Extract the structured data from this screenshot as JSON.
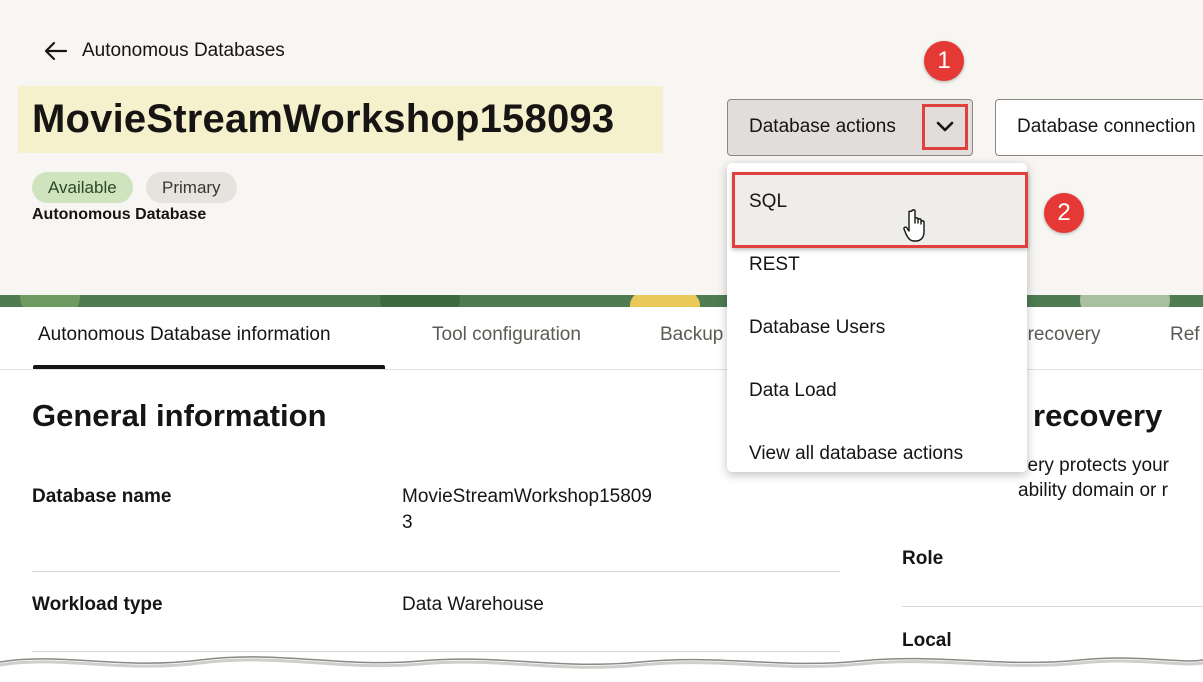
{
  "header": {
    "back_link": "Autonomous Databases",
    "title": "MovieStreamWorkshop158093",
    "badges": [
      "Available",
      "Primary"
    ],
    "subtitle": "Autonomous Database"
  },
  "actions": {
    "database_actions": "Database actions",
    "database_connection": "Database connection"
  },
  "steps": [
    "1",
    "2"
  ],
  "dropdown": {
    "items": [
      "SQL",
      "REST",
      "Database Users",
      "Data Load",
      "View all database actions"
    ]
  },
  "tabs": [
    "Autonomous Database information",
    "Tool configuration",
    "Backup",
    "r recovery",
    "Ref"
  ],
  "general": {
    "heading": "General information",
    "rows": [
      {
        "label": "Database name",
        "value_line1": "MovieStreamWorkshop15809",
        "value_line2": "3"
      },
      {
        "label": "Workload type",
        "value": "Data Warehouse"
      }
    ]
  },
  "recovery": {
    "heading": "recovery",
    "text_line1": "very protects your",
    "text_line2": "ability domain or r",
    "role_label": "Role",
    "local_label": "Local"
  },
  "colors": {
    "accent_red": "#e0413e",
    "header_bg": "#f8f6f3",
    "title_highlight": "#f4f1cc",
    "available_badge": "#cfe3bf"
  }
}
